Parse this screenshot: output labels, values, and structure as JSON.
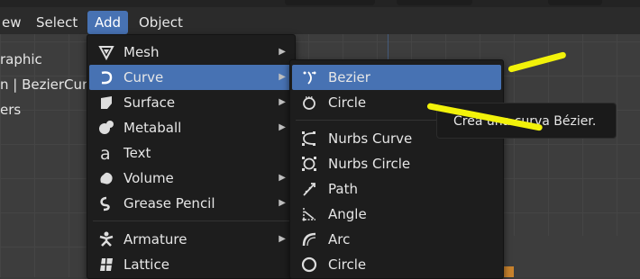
{
  "header_menu": [
    {
      "label": "ew"
    },
    {
      "label": "Select"
    },
    {
      "label": "Add"
    },
    {
      "label": "Object"
    }
  ],
  "viewport_overlay": [
    "raphic",
    "n | BezierCurv",
    "ers"
  ],
  "add_menu": [
    {
      "label": "Mesh",
      "icon": "mesh-icon",
      "submenu": true
    },
    {
      "label": "Curve",
      "icon": "curve-icon",
      "submenu": true
    },
    {
      "label": "Surface",
      "icon": "surface-icon",
      "submenu": true
    },
    {
      "label": "Metaball",
      "icon": "metaball-icon",
      "submenu": true
    },
    {
      "label": "Text",
      "icon": "text-icon",
      "submenu": false
    },
    {
      "label": "Volume",
      "icon": "volume-icon",
      "submenu": true
    },
    {
      "label": "Grease Pencil",
      "icon": "grease-pencil-icon",
      "submenu": true
    },
    {
      "label": "Armature",
      "icon": "armature-icon",
      "submenu": true
    },
    {
      "label": "Lattice",
      "icon": "lattice-icon",
      "submenu": false
    }
  ],
  "curve_submenu": [
    {
      "label": "Bezier",
      "icon": "bezier-icon"
    },
    {
      "label": "Circle",
      "icon": "bezier-circle-icon"
    },
    {
      "label": "Nurbs Curve",
      "icon": "nurbs-curve-icon"
    },
    {
      "label": "Nurbs Circle",
      "icon": "nurbs-circle-icon"
    },
    {
      "label": "Path",
      "icon": "path-icon"
    },
    {
      "label": "Angle",
      "icon": "angle-icon"
    },
    {
      "label": "Arc",
      "icon": "arc-icon"
    },
    {
      "label": "Circle",
      "icon": "circle-icon"
    }
  ],
  "tooltip": "Crea una curva Bézier.",
  "colors": {
    "highlight": "#4772b3",
    "menu_bg": "#1d1d1d",
    "annotation": "#f2f20a"
  }
}
